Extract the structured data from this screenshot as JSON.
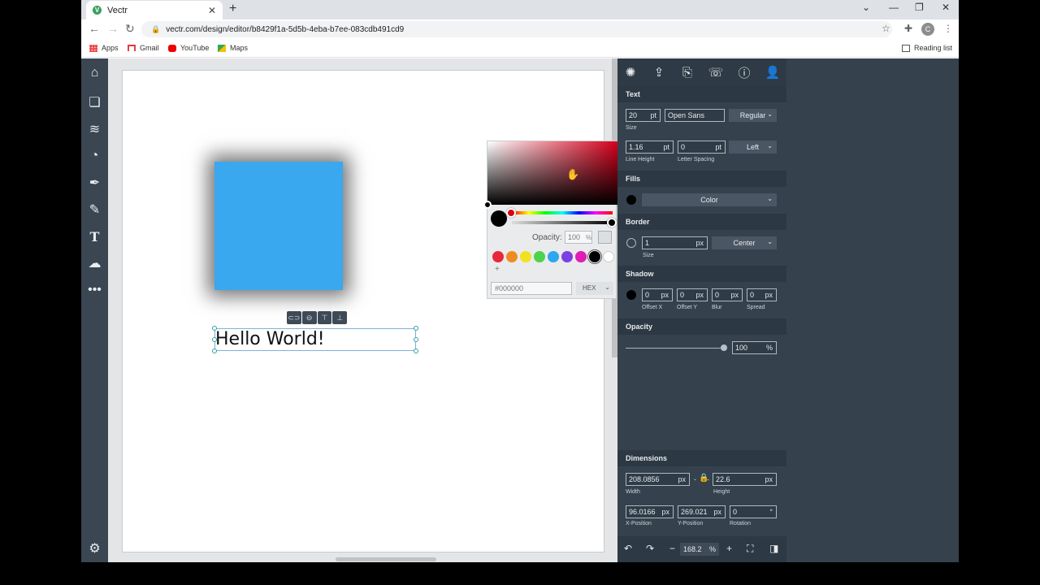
{
  "browser": {
    "tab_title": "Vectr",
    "favicon_letter": "V",
    "url": "vectr.com/design/editor/b8429f1a-5d5b-4eba-b7ee-083cdb491cd9",
    "avatar_letter": "C",
    "bookmarks": [
      "Apps",
      "Gmail",
      "YouTube",
      "Maps"
    ],
    "reading_list": "Reading list"
  },
  "canvas": {
    "text_content": "Hello World!",
    "square_color": "#3aa8ee"
  },
  "color_picker": {
    "opacity_label": "Opacity:",
    "opacity_value": "100",
    "opacity_unit": "%",
    "swatches": [
      "#e8283a",
      "#f08a24",
      "#f2e11f",
      "#4fd24a",
      "#2fa6ee",
      "#7b3fe4",
      "#e01eb4",
      "#000000",
      "#ffffff"
    ],
    "add": "+",
    "hex_value": "#000000",
    "mode": "HEX"
  },
  "panel": {
    "text": {
      "heading": "Text",
      "size": "20",
      "size_unit": "pt",
      "size_label": "Size",
      "font": "Open Sans",
      "weight": "Regular",
      "line_height": "1.16",
      "line_height_unit": "pt",
      "line_height_label": "Line Height",
      "letter_spacing": "0",
      "letter_spacing_unit": "pt",
      "letter_spacing_label": "Letter Spacing",
      "align": "Left"
    },
    "fills": {
      "heading": "Fills",
      "type": "Color"
    },
    "border": {
      "heading": "Border",
      "size": "1",
      "unit": "px",
      "size_label": "Size",
      "position": "Center"
    },
    "shadow": {
      "heading": "Shadow",
      "offset_x": "0",
      "offset_y": "0",
      "blur": "0",
      "spread": "0",
      "unit": "px",
      "labels": [
        "Offset X",
        "Offset Y",
        "Blur",
        "Spread"
      ]
    },
    "opacity": {
      "heading": "Opacity",
      "value": "100",
      "unit": "%"
    },
    "dimensions": {
      "heading": "Dimensions",
      "width": "208.0856",
      "height": "22.6",
      "unit": "px",
      "width_label": "Width",
      "height_label": "Height",
      "x": "96.0166",
      "y": "269.021",
      "rotation": "0",
      "rotation_unit": "°",
      "x_label": "X-Position",
      "y_label": "Y-Position",
      "rotation_label": "Rotation",
      "link_sep": "-"
    },
    "zoom": {
      "value": "168.2",
      "unit": "%"
    }
  },
  "icons": {
    "rail": [
      "home-icon",
      "pages-icon",
      "layers-icon",
      "shapes-icon",
      "pen-tool-icon",
      "pencil-icon",
      "text-tool-icon",
      "upload-icon",
      "more-icon",
      "settings-icon"
    ],
    "top": [
      "properties-icon",
      "export-icon",
      "share-icon",
      "comments-icon",
      "info-icon",
      "account-icon"
    ]
  }
}
